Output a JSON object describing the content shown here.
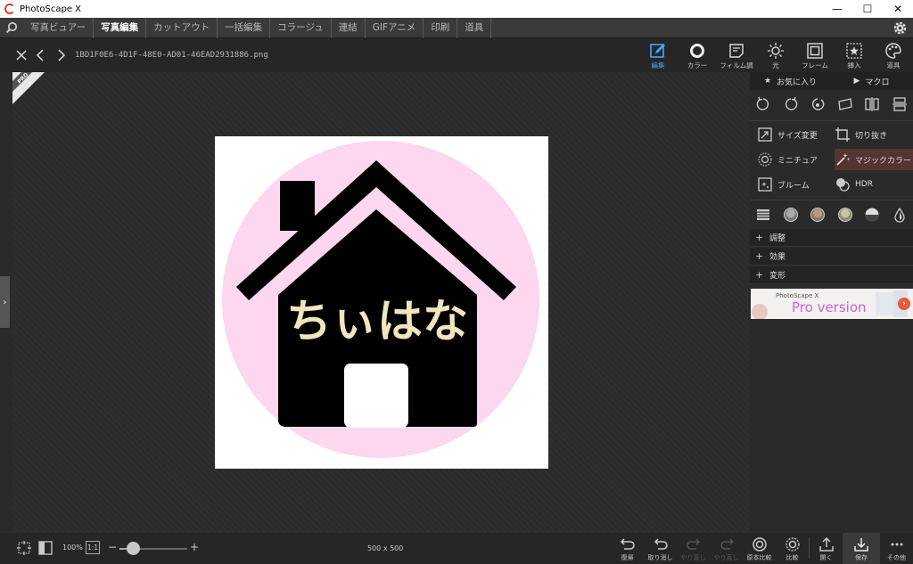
{
  "app": {
    "title": "PhotoScape X"
  },
  "window_controls": {
    "minimize": "—",
    "maximize": "☐",
    "close": "✕"
  },
  "nav": {
    "tabs": [
      {
        "label": "写真ビュアー",
        "active": false
      },
      {
        "label": "写真編集",
        "active": true
      },
      {
        "label": "カットアウト",
        "active": false
      },
      {
        "label": "一括編集",
        "active": false
      },
      {
        "label": "コラージュ",
        "active": false
      },
      {
        "label": "連結",
        "active": false
      },
      {
        "label": "GIFアニメ",
        "active": false
      },
      {
        "label": "印刷",
        "active": false
      },
      {
        "label": "道具",
        "active": false
      }
    ]
  },
  "file": {
    "name": "1BD1F0E6-4D1F-48E0-AD01-46EAD2931886.png"
  },
  "toolbar": {
    "edit": "編集",
    "color": "カラー",
    "film": "フィルム調",
    "light": "光",
    "frame": "フレーム",
    "insert": "挿入",
    "tools": "道具"
  },
  "ribbon": {
    "text": "PRO"
  },
  "photo": {
    "caption_text": "ちぃはな",
    "circle_color": "#fdd6ef",
    "house_color": "#000000",
    "text_color": "#f1e5bd"
  },
  "panel": {
    "favorites": "お気に入り",
    "macro": "マクロ",
    "resize": "サイズ変更",
    "crop": "切り抜き",
    "miniature": "ミニチュア",
    "magic_color": "マジックカラー",
    "bloom": "ブルーム",
    "hdr": "HDR",
    "adjust": "調整",
    "effects": "効果",
    "transform": "変形",
    "promo_small": "PhotoScape X",
    "promo_big": "Pro version"
  },
  "bottom": {
    "zoom": "100%",
    "zoom_11": "1:1",
    "zoom_level": 0.2,
    "dims": "500 x 500",
    "revert": "復帰",
    "undo": "取り消し",
    "redo": "やり直し",
    "redo_all": "やり直し",
    "compare_orig": "原本比較",
    "compare": "比較",
    "open": "開く",
    "save": "保存",
    "more": "その他"
  },
  "colors": {
    "accent": "#3ea8ff",
    "highlight": "#553432",
    "promo_arrow": "#e35c3c"
  }
}
